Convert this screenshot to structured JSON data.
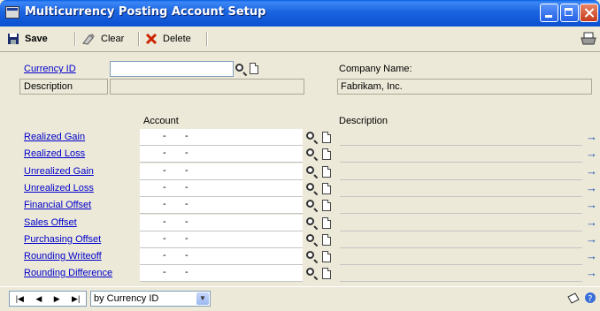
{
  "window": {
    "title": "Multicurrency Posting Account Setup"
  },
  "toolbar": {
    "save": "Save",
    "clear": "Clear",
    "delete": "Delete"
  },
  "header": {
    "currency_id_label": "Currency ID",
    "currency_id_value": "",
    "description_label": "Description",
    "description_value": "",
    "company_name_label": "Company Name:",
    "company_name_value": "Fabrikam, Inc."
  },
  "grid": {
    "account_header": "Account",
    "description_header": "Description",
    "rows": [
      {
        "label": "Realized Gain",
        "account": "-       -",
        "description": ""
      },
      {
        "label": "Realized Loss",
        "account": "-       -",
        "description": ""
      },
      {
        "label": "Unrealized Gain",
        "account": "-       -",
        "description": ""
      },
      {
        "label": "Unrealized Loss",
        "account": "-       -",
        "description": ""
      },
      {
        "label": "Financial Offset",
        "account": "-       -",
        "description": ""
      },
      {
        "label": "Sales Offset",
        "account": "-       -",
        "description": ""
      },
      {
        "label": "Purchasing Offset",
        "account": "-       -",
        "description": ""
      },
      {
        "label": "Rounding Writeoff",
        "account": "-       -",
        "description": ""
      },
      {
        "label": "Rounding Difference",
        "account": "-       -",
        "description": ""
      }
    ]
  },
  "status": {
    "sort_by": "by Currency ID"
  },
  "icons": [
    "save-icon",
    "clear-icon",
    "delete-icon",
    "print-icon",
    "lookup-icon",
    "new-document-icon",
    "expand-arrow-icon",
    "first-record-icon",
    "previous-record-icon",
    "next-record-icon",
    "last-record-icon",
    "note-icon",
    "help-icon"
  ]
}
